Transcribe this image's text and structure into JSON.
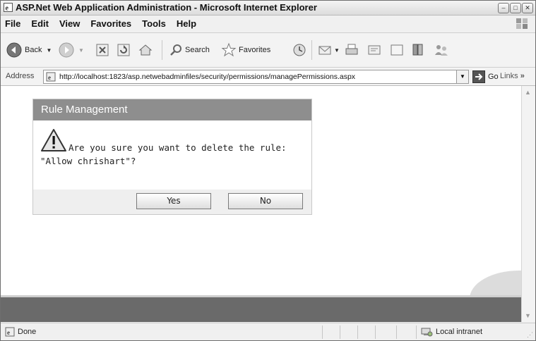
{
  "window": {
    "title": "ASP.Net Web Application Administration - Microsoft Internet Explorer"
  },
  "menu": {
    "items": [
      "File",
      "Edit",
      "View",
      "Favorites",
      "Tools",
      "Help"
    ]
  },
  "toolbar": {
    "back_label": "Back",
    "search_label": "Search",
    "favorites_label": "Favorites"
  },
  "address": {
    "label": "Address",
    "url": "http://localhost:1823/asp.netwebadminfiles/security/permissions/managePermissions.aspx",
    "go_label": "Go",
    "links_label": "Links"
  },
  "dialog": {
    "title": "Rule Management",
    "message_line1": "Are you sure you want to delete the rule:",
    "message_line2": "\"Allow chrishart\"?",
    "yes_label": "Yes",
    "no_label": "No"
  },
  "status": {
    "text": "Done",
    "zone": "Local intranet"
  },
  "colors": {
    "dialog_header": "#8e8e8e",
    "bottom_band": "#6a6a6a"
  }
}
